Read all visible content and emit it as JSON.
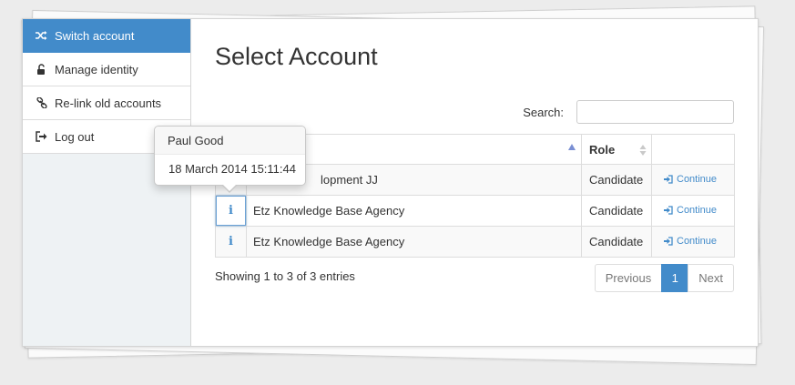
{
  "sidebar": {
    "items": [
      {
        "label": "Switch account",
        "icon": "shuffle-icon",
        "active": true
      },
      {
        "label": "Manage identity",
        "icon": "unlock-icon",
        "active": false
      },
      {
        "label": "Re-link old accounts",
        "icon": "link-icon",
        "active": false
      },
      {
        "label": "Log out",
        "icon": "sign-out-icon",
        "active": false
      }
    ]
  },
  "main": {
    "title": "Select Account",
    "search": {
      "label": "Search:",
      "value": "",
      "placeholder": ""
    },
    "table": {
      "columns": [
        "",
        "",
        "Role",
        ""
      ],
      "rows": [
        {
          "info": "i",
          "name": "lopment JJ",
          "role": "Candidate",
          "action": "Continue"
        },
        {
          "info": "i",
          "name": "Etz Knowledge Base Agency",
          "role": "Candidate",
          "action": "Continue"
        },
        {
          "info": "i",
          "name": "Etz Knowledge Base Agency",
          "role": "Candidate",
          "action": "Continue"
        }
      ]
    },
    "info_text": "Showing 1 to 3 of 3 entries",
    "pagination": {
      "previous": "Previous",
      "current": "1",
      "next": "Next"
    }
  },
  "popover": {
    "title": "Paul Good",
    "body": "18 March 2014 15:11:44"
  },
  "colors": {
    "accent": "#428bca",
    "sort_arrow": "#7a8fd3"
  }
}
